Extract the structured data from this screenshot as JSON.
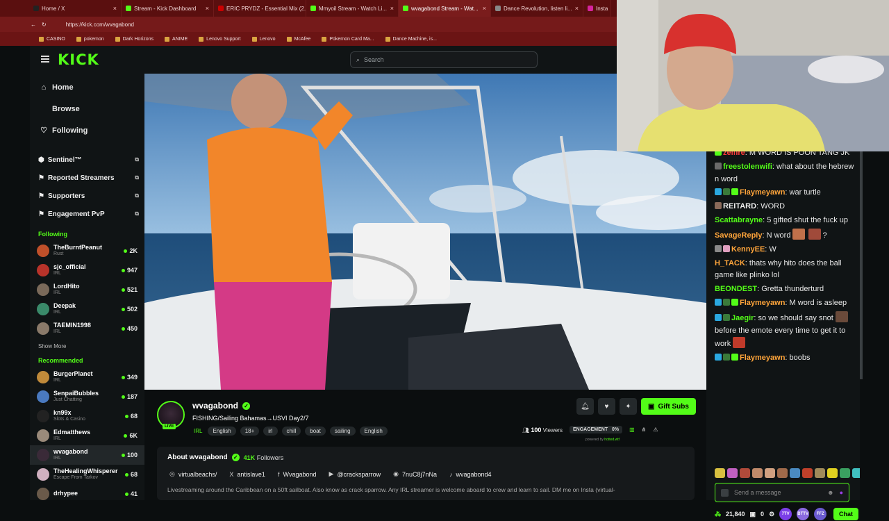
{
  "browser": {
    "tabs": [
      {
        "label": "Home / X",
        "favicon": "#222222"
      },
      {
        "label": "Stream - Kick Dashboard",
        "favicon": "#53fc18"
      },
      {
        "label": "ERIC PRYDZ - Essential Mix (2...",
        "favicon": "#cc0000"
      },
      {
        "label": "Mmyoil Stream - Watch Li...",
        "favicon": "#53fc18"
      },
      {
        "label": "wvagabond Stream - Wat...",
        "favicon": "#53fc18",
        "active": true
      },
      {
        "label": "Dance Revolution, listen li...",
        "favicon": "#888888"
      },
      {
        "label": "Insta",
        "favicon": "#d6249f"
      }
    ],
    "url": "https://kick.com/wvagabond",
    "bookmarks": [
      "CASINO",
      "pokemon",
      "Dark Horizons",
      "ANIME",
      "Lenovo Support",
      "Lenovo",
      "McAfee",
      "Pokemon Card Ma...",
      "Dance Machine, is..."
    ]
  },
  "site": {
    "logo": "KICK",
    "search_placeholder": "Search"
  },
  "sidebar": {
    "nav": [
      {
        "label": "Home",
        "icon": "home-icon",
        "glyph": "⌂"
      },
      {
        "label": "Browse",
        "icon": "compass-icon",
        "glyph": ""
      },
      {
        "label": "Following",
        "icon": "heart-icon",
        "glyph": "♡"
      }
    ],
    "tools": [
      {
        "label": "Sentinel™",
        "icon": "shield-icon",
        "glyph": "⬢"
      },
      {
        "label": "Reported Streamers",
        "icon": "flag-icon",
        "glyph": "⚑"
      },
      {
        "label": "Supporters",
        "icon": "flag-icon",
        "glyph": "⚑"
      },
      {
        "label": "Engagement PvP",
        "icon": "flag-icon",
        "glyph": "⚑"
      }
    ],
    "following_title": "Following",
    "following": [
      {
        "name": "TheBurntPeanut",
        "category": "Rust",
        "viewers": "2K",
        "color": "#c0502a"
      },
      {
        "name": "sjc_official",
        "category": "IRL",
        "viewers": "947",
        "color": "#b8332a"
      },
      {
        "name": "LordHito",
        "category": "IRL",
        "viewers": "521",
        "color": "#7a6a5a"
      },
      {
        "name": "Deepak",
        "category": "IRL",
        "viewers": "502",
        "color": "#3a8a6a"
      },
      {
        "name": "TAEMIN1998",
        "category": "IRL",
        "viewers": "450",
        "color": "#8a7a6a"
      }
    ],
    "show_more": "Show More",
    "recommended_title": "Recommended",
    "recommended": [
      {
        "name": "BurgerPlanet",
        "category": "IRL",
        "viewers": "349",
        "color": "#c08a3a"
      },
      {
        "name": "SenpaiBubbles",
        "category": "Just Chatting",
        "viewers": "187",
        "color": "#4a7ac0"
      },
      {
        "name": "kn99x",
        "category": "Slots & Casino",
        "viewers": "68",
        "color": "#222222"
      },
      {
        "name": "Edmatthews",
        "category": "IRL",
        "viewers": "6K",
        "color": "#9a8a7a"
      },
      {
        "name": "wvagabond",
        "category": "IRL",
        "viewers": "100",
        "color": "#3a2a38",
        "selected": true
      },
      {
        "name": "TheHealingWhisperer",
        "category": "Escape From Tarkov",
        "viewers": "68",
        "color": "#d0b0c0"
      },
      {
        "name": "drhypee",
        "category": "",
        "viewers": "41",
        "color": "#6a5a4a"
      }
    ]
  },
  "stream": {
    "streamer": "wvagabond",
    "live_label": "LIVE",
    "title": "FISHING/Sailing Bahamas→USVI Day2/7",
    "category": "IRL",
    "tags": [
      "English",
      "18+",
      "irl",
      "chill",
      "boat",
      "sailing",
      "English"
    ],
    "gift_label": "Gift Subs",
    "viewers_count": "100",
    "viewers_label": "Viewers",
    "engagement_label": "ENGAGEMENT",
    "engagement_value": "0%",
    "powered_by": "powered by",
    "powered_by_brand": "hotted.wtf"
  },
  "about": {
    "title": "About wvagabond",
    "followers_count": "41K",
    "followers_label": "Followers",
    "socials": [
      {
        "label": "virtualbeachs/",
        "icon": "instagram-icon",
        "glyph": "◎"
      },
      {
        "label": "antislave1",
        "icon": "x-icon",
        "glyph": "X"
      },
      {
        "label": "Wvagabond",
        "icon": "facebook-icon",
        "glyph": "f"
      },
      {
        "label": "@cracksparrow",
        "icon": "youtube-icon",
        "glyph": "▶"
      },
      {
        "label": "7nuC8j7nNa",
        "icon": "discord-icon",
        "glyph": "◉"
      },
      {
        "label": "wvagabond4",
        "icon": "tiktok-icon",
        "glyph": "♪"
      }
    ],
    "bio": "Livestreaming around the Caribbean on a 50ft sailboat. Also know as crack sparrow. Any IRL streamer is welcome aboard to crew and learn to sail. DM me on Insta (virtual-"
  },
  "chat": {
    "messages": [
      {
        "user": "zelfire",
        "color": "#ff3b3b",
        "text": "M WORD IS POON TANG JK",
        "badges": [
          "#53fc18"
        ]
      },
      {
        "user": "freestolenwifi",
        "color": "#53fc18",
        "text": "what about the hebrew n word",
        "badges": [
          "#6a6a6a"
        ]
      },
      {
        "user": "Flaymeyawn",
        "color": "#ffa53b",
        "text": "war turtle",
        "badges": [
          "#2aa8e0",
          "#3a7a3a",
          "#53fc18"
        ]
      },
      {
        "user": "REITARD",
        "color": "#eeeeee",
        "text": "WORD",
        "badges": [
          "#8a6a5a"
        ]
      },
      {
        "user": "Scattabrayne",
        "color": "#53fc18",
        "text": "5 gifted shut the fuck up",
        "badges": []
      },
      {
        "user": "SavageReply",
        "color": "#ffa53b",
        "text": "N word",
        "suffix": "?",
        "emotes": [
          "#c0704a",
          "#a04a3a"
        ],
        "badges": []
      },
      {
        "user": "KennyEE",
        "color": "#ffa53b",
        "text": "W",
        "badges": [
          "#8a8a8a",
          "#e0a0c0"
        ]
      },
      {
        "user": "H_TACK",
        "color": "#ffa53b",
        "text": "thats why hito does the ball game like plinko lol",
        "badges": []
      },
      {
        "user": "BEONDEST",
        "color": "#53fc18",
        "text": "Gretta thunderturd",
        "badges": []
      },
      {
        "user": "Flaymeyawn",
        "color": "#ffa53b",
        "text": "M word is asleep",
        "badges": [
          "#2aa8e0",
          "#3a7a3a",
          "#53fc18"
        ]
      },
      {
        "user": "Jaegir",
        "color": "#53fc18",
        "text": "so we should say snot",
        "emotes": [
          "#6a4a3a"
        ],
        "text2": "before the emote every time to get it to work",
        "emotes2": [
          "#c03a2a"
        ],
        "badges": [
          "#2aa8e0",
          "#3a7a3a"
        ]
      },
      {
        "user": "Flaymeyawn",
        "color": "#ffa53b",
        "text": "boobs",
        "badges": [
          "#2aa8e0",
          "#3a7a3a",
          "#53fc18"
        ]
      }
    ],
    "emotes": [
      "#d8c040",
      "#c060c0",
      "#b04a3a",
      "#c08a6a",
      "#d0a080",
      "#a06a4a",
      "#4a8ac0",
      "#c0402a",
      "#a08a5a",
      "#e0d020",
      "#3aa060",
      "#40c0c0"
    ],
    "input_placeholder": "Send a message",
    "points": "21,840",
    "gift_count": "0",
    "chat_button": "Chat",
    "pill_labels": [
      "7TV",
      "BTTV",
      "FFZ"
    ]
  }
}
